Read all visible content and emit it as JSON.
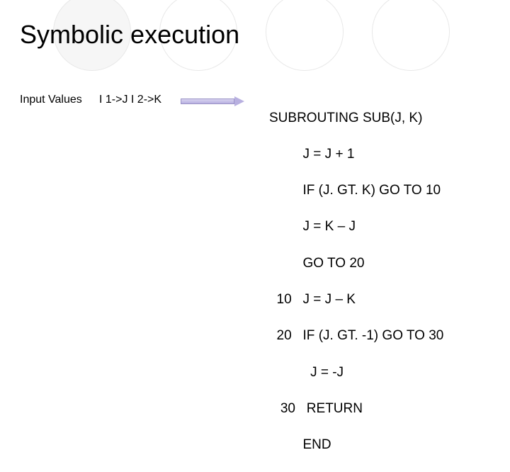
{
  "title": "Symbolic execution",
  "input": {
    "label": "Input Values",
    "values": "I 1->J  I 2->K"
  },
  "code": {
    "l0": "SUBROUTING SUB(J, K)",
    "l1": "         J = J + 1",
    "l2": "         IF (J. GT. K) GO TO 10",
    "l3": "         J = K – J",
    "l4": "         GO TO 20",
    "l5": "  10   J = J – K",
    "l6": "  20   IF (J. GT. -1) GO TO 30",
    "l7": "           J = -J",
    "l8": "   30   RETURN",
    "l9": "         END"
  }
}
